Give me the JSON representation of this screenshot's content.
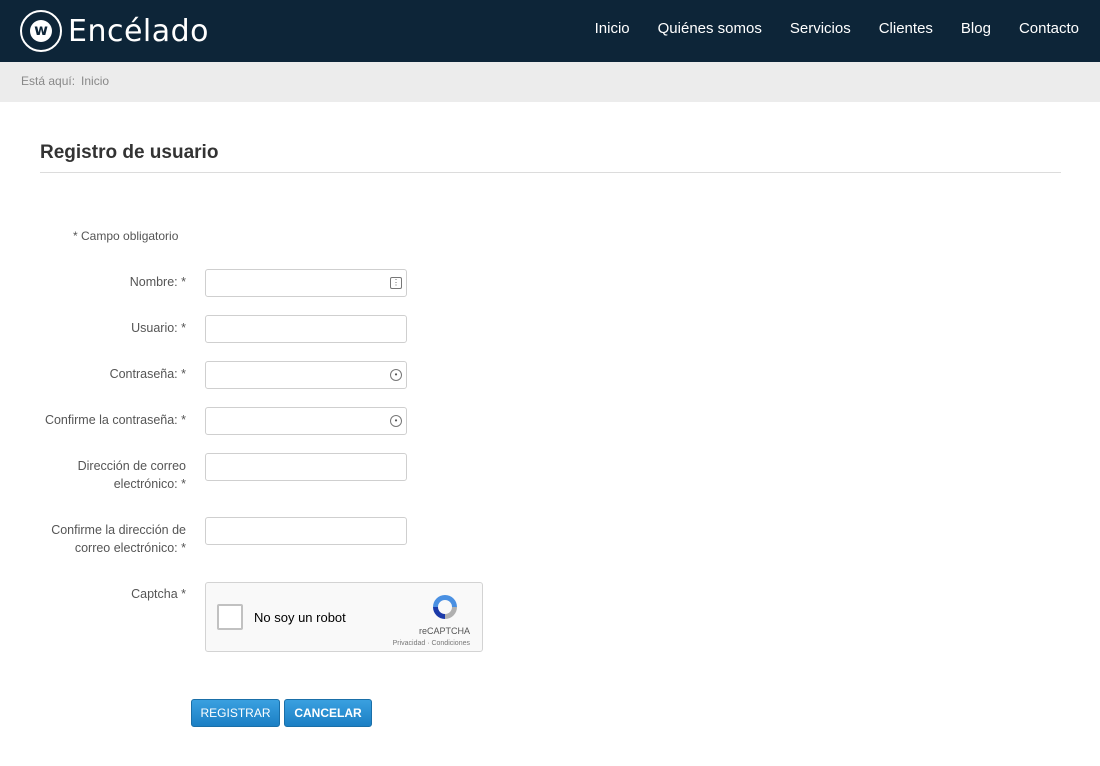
{
  "brand": {
    "name": "Encélado",
    "mark": "w"
  },
  "nav": [
    {
      "label": "Inicio"
    },
    {
      "label": "Quiénes somos"
    },
    {
      "label": "Servicios"
    },
    {
      "label": "Clientes"
    },
    {
      "label": "Blog"
    },
    {
      "label": "Contacto"
    }
  ],
  "breadcrumb": {
    "prefix": "Está aquí:",
    "current": "Inicio"
  },
  "page": {
    "title": "Registro de usuario"
  },
  "form": {
    "required_note": "* Campo obligatorio",
    "fields": [
      {
        "label": "Nombre: *",
        "value": "",
        "icon": "contact-card-icon"
      },
      {
        "label": "Usuario: *",
        "value": ""
      },
      {
        "label": "Contraseña: *",
        "value": "",
        "icon": "password-key-icon"
      },
      {
        "label": "Confirme la contraseña: *",
        "value": "",
        "icon": "password-key-icon"
      },
      {
        "label_line1": "Dirección de correo",
        "label_line2": "electrónico: *",
        "value": ""
      },
      {
        "label_line1": "Confirme la dirección de",
        "label_line2": "correo electrónico: *",
        "value": ""
      }
    ],
    "captcha": {
      "label": "Captcha *",
      "checkbox_text": "No soy un robot",
      "brand": "reCAPTCHA",
      "terms": "Privacidad · Condiciones"
    },
    "buttons": {
      "submit": "REGISTRAR",
      "cancel": "CANCELAR"
    }
  },
  "colors": {
    "header_bg": "#0d2538",
    "crumb_bg": "#ececec",
    "button": "#2a8fd4"
  }
}
